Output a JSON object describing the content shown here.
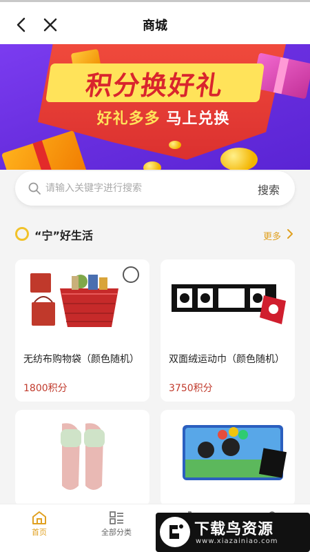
{
  "header": {
    "title": "商城"
  },
  "banner": {
    "headline": "积分换好礼",
    "subline_a": "好礼多多",
    "subline_b": "马上兑换"
  },
  "search": {
    "placeholder": "请输入关键字进行搜索",
    "button_label": "搜索"
  },
  "section": {
    "title": "“宁”好生活",
    "more_label": "更多"
  },
  "products": [
    {
      "name": "无纺布购物袋（颜色随机）",
      "points": "1800积分"
    },
    {
      "name": "双面绒运动巾（颜色随机）",
      "points": "3750积分"
    },
    {
      "name": "",
      "points": ""
    },
    {
      "name": "",
      "points": ""
    }
  ],
  "tabbar": {
    "items": [
      {
        "label": "首页",
        "icon": "home-icon",
        "active": true
      },
      {
        "label": "全部分类",
        "icon": "category-icon",
        "active": false
      },
      {
        "label": "",
        "icon": "cart-icon",
        "active": false
      },
      {
        "label": "",
        "icon": "user-icon",
        "active": false
      }
    ]
  },
  "watermark": {
    "title": "下载鸟资源",
    "url": "www.xiazainiao.com"
  },
  "colors": {
    "accent": "#e0a020",
    "price": "#c0392b",
    "banner_purple": "#6a2fe0",
    "banner_red": "#d92e2e"
  }
}
